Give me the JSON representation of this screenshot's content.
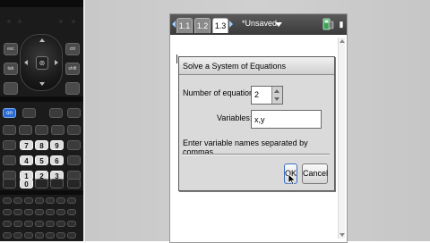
{
  "keypad": {
    "touchpad_center": "⊛",
    "side_buttons": [
      "esc",
      "tab",
      "ctrl",
      "shift"
    ],
    "blue_key": "on"
  },
  "document": {
    "tabs": [
      "1.1",
      "1.2",
      "1.3"
    ],
    "active_tab": "1.3",
    "title": "*Unsaved",
    "tab_bar_color": "#404040",
    "accent": "#9fd0ff"
  },
  "dialog": {
    "title": "Solve a System of Equations",
    "num_equations_label": "Number of equations",
    "num_equations_value": "2",
    "variables_label": "Variables:",
    "variables_value": "x,y",
    "hint": "Enter variable names separated by commas",
    "ok_label": "OK",
    "cancel_label": "Cancel"
  },
  "icons": {
    "prev_tab": "chevron-left-icon",
    "next_tab": "chevron-right-icon",
    "doc_menu": "chevron-down-icon",
    "mode": "calculator-mode-icon",
    "pointer": "mouse-pointer-icon"
  }
}
